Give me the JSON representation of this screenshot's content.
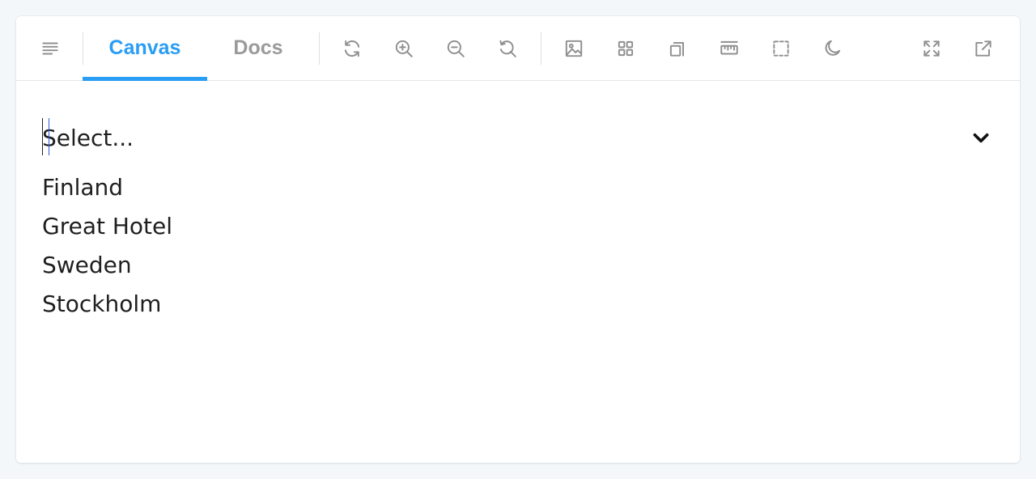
{
  "colors": {
    "accent": "#2a9df4",
    "tab_inactive": "#9a9a9a",
    "icon": "#8f8f8f",
    "text": "#1f1f1f"
  },
  "toolbar": {
    "left_icons": [
      "align-left-icon"
    ],
    "tabs": [
      {
        "label": "Canvas",
        "active": true
      },
      {
        "label": "Docs",
        "active": false
      }
    ],
    "icons": [
      "refresh-icon",
      "zoom-in-icon",
      "zoom-out-icon",
      "reset-zoom-icon",
      "image-icon",
      "grid-icon",
      "outline-icon",
      "ruler-icon",
      "measure-icon",
      "dark-mode-icon"
    ],
    "right_icons": [
      "fullscreen-icon",
      "open-external-icon"
    ]
  },
  "select": {
    "placeholder": "Select...",
    "options": [
      "Finland",
      "Great Hotel",
      "Sweden",
      "Stockholm"
    ]
  }
}
